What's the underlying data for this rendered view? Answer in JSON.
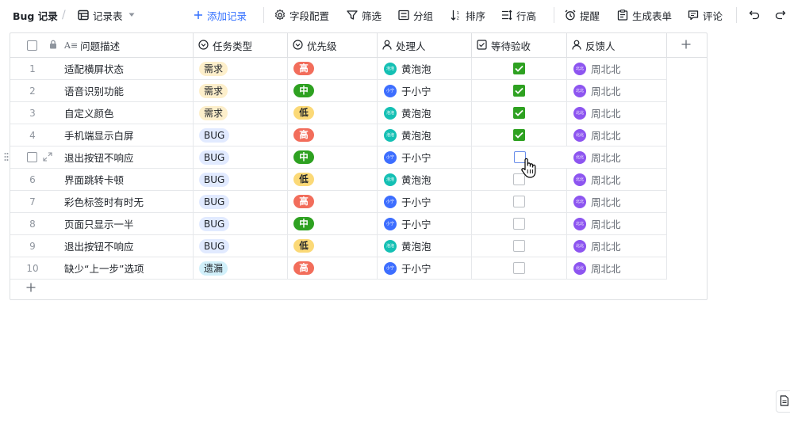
{
  "toolbar": {
    "app_title": "Bug 记录",
    "slash": "/",
    "view_name": "记录表",
    "add_record": "添加记录",
    "field_config": "字段配置",
    "filter": "筛选",
    "group": "分组",
    "sort": "排序",
    "row_height": "行高",
    "remind": "提醒",
    "generate_form": "生成表单",
    "comment": "评论"
  },
  "columns": {
    "description": "问题描述",
    "task_type": "任务类型",
    "priority": "优先级",
    "assignee": "处理人",
    "awaiting_check": "等待验收",
    "reporter": "反馈人"
  },
  "colors": {
    "need_bg": "#fdefcb",
    "bug_bg": "#e1eaff",
    "omit_bg": "#d1f0fa",
    "high": "#f26d5b",
    "mid": "#2ea121",
    "low": "#fbd977",
    "avatar_teal": "#14c0b4",
    "avatar_blue": "#3d6eff",
    "avatar_purple": "#8d55f0",
    "check_green": "#2ea121",
    "accent": "#3370ff"
  },
  "rows": [
    {
      "num": "1",
      "desc": "适配横屏状态",
      "type": "需求",
      "type_style": "need",
      "pri": "高",
      "pri_style": "high",
      "assignee": "黄泡泡",
      "assignee_avatar": "泡泡",
      "avatar_style": "teal",
      "checked": true,
      "reporter": "周北北",
      "reporter_avatar": "北北"
    },
    {
      "num": "2",
      "desc": "语音识别功能",
      "type": "需求",
      "type_style": "need",
      "pri": "中",
      "pri_style": "mid",
      "assignee": "于小宁",
      "assignee_avatar": "小宁",
      "avatar_style": "blue",
      "checked": true,
      "reporter": "周北北",
      "reporter_avatar": "北北"
    },
    {
      "num": "3",
      "desc": "自定义颜色",
      "type": "需求",
      "type_style": "need",
      "pri": "低",
      "pri_style": "low",
      "assignee": "黄泡泡",
      "assignee_avatar": "泡泡",
      "avatar_style": "teal",
      "checked": true,
      "reporter": "周北北",
      "reporter_avatar": "北北"
    },
    {
      "num": "4",
      "desc": "手机端显示白屏",
      "type": "BUG",
      "type_style": "bug",
      "pri": "高",
      "pri_style": "high",
      "assignee": "黄泡泡",
      "assignee_avatar": "泡泡",
      "avatar_style": "teal",
      "checked": true,
      "reporter": "周北北",
      "reporter_avatar": "北北"
    },
    {
      "num": "5",
      "desc": "退出按钮不响应",
      "type": "BUG",
      "type_style": "bug",
      "pri": "中",
      "pri_style": "mid",
      "assignee": "于小宁",
      "assignee_avatar": "小宁",
      "avatar_style": "blue",
      "checked": false,
      "focus": true,
      "reporter": "周北北",
      "reporter_avatar": "北北"
    },
    {
      "num": "6",
      "desc": "界面跳转卡顿",
      "type": "BUG",
      "type_style": "bug",
      "pri": "低",
      "pri_style": "low",
      "assignee": "黄泡泡",
      "assignee_avatar": "泡泡",
      "avatar_style": "teal",
      "checked": false,
      "reporter": "周北北",
      "reporter_avatar": "北北"
    },
    {
      "num": "7",
      "desc": "彩色标签时有时无",
      "type": "BUG",
      "type_style": "bug",
      "pri": "高",
      "pri_style": "high",
      "assignee": "于小宁",
      "assignee_avatar": "小宁",
      "avatar_style": "blue",
      "checked": false,
      "reporter": "周北北",
      "reporter_avatar": "北北"
    },
    {
      "num": "8",
      "desc": "页面只显示一半",
      "type": "BUG",
      "type_style": "bug",
      "pri": "中",
      "pri_style": "mid",
      "assignee": "于小宁",
      "assignee_avatar": "小宁",
      "avatar_style": "blue",
      "checked": false,
      "reporter": "周北北",
      "reporter_avatar": "北北"
    },
    {
      "num": "9",
      "desc": "退出按钮不响应",
      "type": "BUG",
      "type_style": "bug",
      "pri": "低",
      "pri_style": "low",
      "assignee": "黄泡泡",
      "assignee_avatar": "泡泡",
      "avatar_style": "teal",
      "checked": false,
      "reporter": "周北北",
      "reporter_avatar": "北北"
    },
    {
      "num": "10",
      "desc": "缺少“上一步”选项",
      "type": "遗漏",
      "type_style": "omit",
      "pri": "高",
      "pri_style": "high",
      "assignee": "于小宁",
      "assignee_avatar": "小宁",
      "avatar_style": "blue",
      "checked": false,
      "reporter": "周北北",
      "reporter_avatar": "北北"
    }
  ]
}
